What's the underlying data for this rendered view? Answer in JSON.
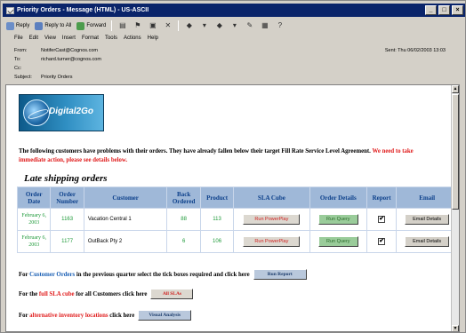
{
  "window": {
    "title": "Priority Orders - Message (HTML) - US-ASCII"
  },
  "toolbar": {
    "reply": "Reply",
    "reply_all": "Reply to All",
    "forward": "Forward"
  },
  "menu": [
    "File",
    "Edit",
    "View",
    "Insert",
    "Format",
    "Tools",
    "Actions",
    "Help"
  ],
  "headers": {
    "from_label": "From:",
    "from_value": "NotiferCast@Cognos.com",
    "to_label": "To:",
    "to_value": "richard.turner@cognos.com",
    "cc_label": "Cc:",
    "cc_value": "",
    "subject_label": "Subject:",
    "subject_value": "Priority Orders",
    "sent": "Sent:   Thu 06/02/2003 13:03"
  },
  "logo": {
    "text": "Digital2Go"
  },
  "intro": {
    "text": "The following customers have problems with their orders.  They have already fallen below their target Fill Rate Service Level Agreement. ",
    "red": "We need to take immediate action, please see details below."
  },
  "heading": "Late shipping orders",
  "table": {
    "columns": [
      "Order Date",
      "Order Number",
      "Customer",
      "Back Ordered",
      "Product",
      "SLA Cube",
      "Order Details",
      "Report",
      "Email"
    ],
    "rows": [
      {
        "date": "February 6, 2003",
        "number": "1163",
        "customer": "Vacation Central 1",
        "back": "88",
        "product": "113",
        "sla": "Run PowerPlay",
        "details": "Run Query",
        "report": "✔",
        "email": "Email Details"
      },
      {
        "date": "February 6, 2003",
        "number": "1177",
        "customer": "OutBack Pty 2",
        "back": "6",
        "product": "106",
        "sla": "Run PowerPlay",
        "details": "Run Query",
        "report": "✔",
        "email": "Email Details"
      }
    ]
  },
  "footer": {
    "line1_pre": "For ",
    "line1_link": "Customer Orders",
    "line1_post": " in the previous quarter select the tick boxes required and click here",
    "line1_btn": "Run Report",
    "line2_pre": "For the ",
    "line2_link": "full SLA cube",
    "line2_post": " for all Customers click here",
    "line2_btn": "All SLAs",
    "line3_pre": "For ",
    "line3_link": "alternative inventory locations",
    "line3_post": " click here",
    "line3_btn": "Visual Analysis"
  }
}
